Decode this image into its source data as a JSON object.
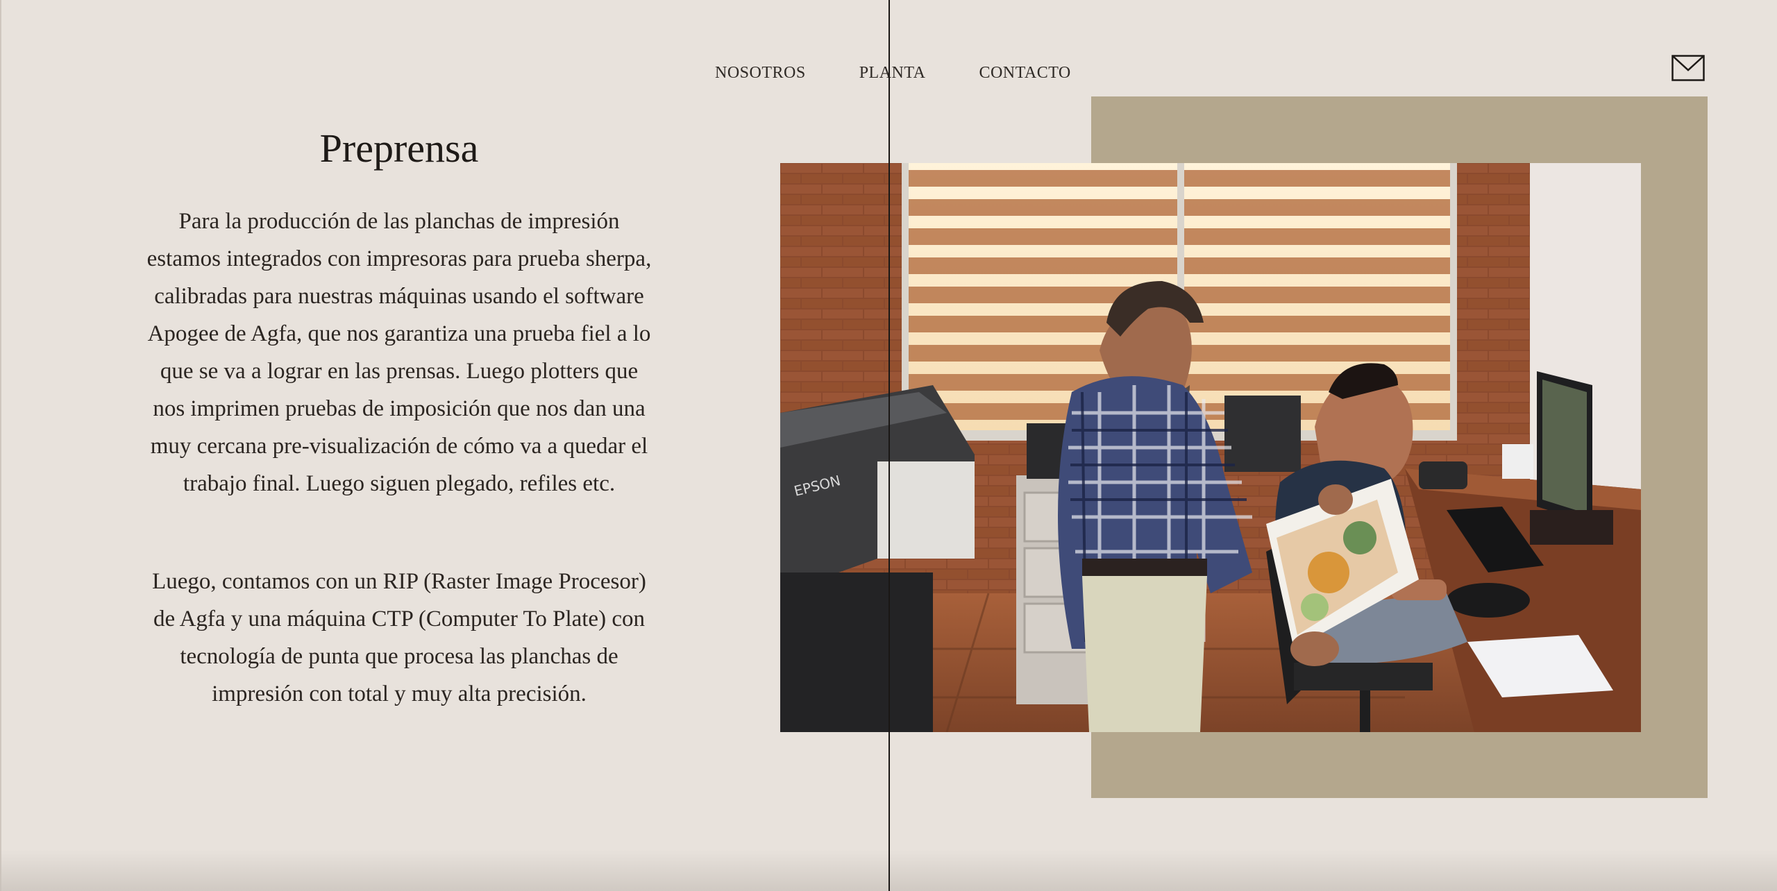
{
  "nav": {
    "items": [
      "NOSOTROS",
      "PLANTA",
      "CONTACTO"
    ]
  },
  "header": {
    "mail_icon": "envelope-icon"
  },
  "main": {
    "title": "Preprensa",
    "paragraph_1": "Para la producción de las planchas de impresión estamos integrados con impresoras para prueba sherpa, calibradas para nuestras máquinas usando el software Apogee de Agfa, que nos garantiza una prueba fiel a lo que se va a lograr en las prensas. Luego plotters que nos imprimen pruebas de imposición que nos dan una muy cercana pre-visualización de cómo va a quedar el trabajo final. Luego siguen plegado, refiles etc.",
    "paragraph_2": "Luego, contamos con un RIP (Raster Image Procesor) de Agfa y una máquina CTP (Computer To Plate) con tecnología de punta que procesa las planchas de impresión con total y muy alta precisión."
  },
  "photo": {
    "printer_brand": "EPSON"
  },
  "colors": {
    "background": "#e8e2dc",
    "panel": "#b4a78d",
    "text": "#2b2521"
  }
}
